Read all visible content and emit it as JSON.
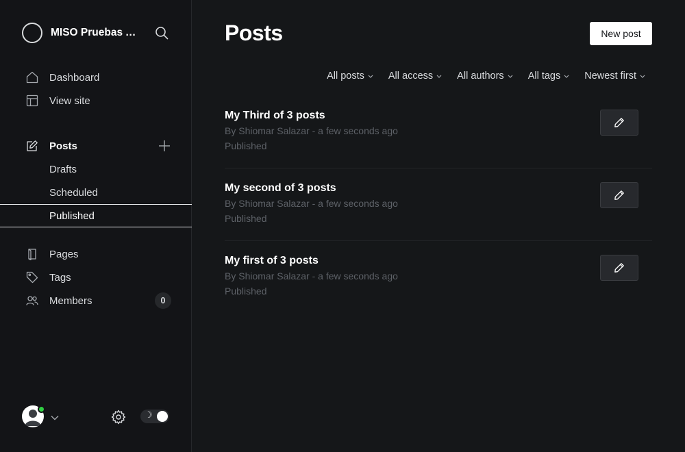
{
  "site": {
    "title": "MISO Pruebas Automatizadas"
  },
  "nav": {
    "dashboard": "Dashboard",
    "view_site": "View site",
    "posts": "Posts",
    "drafts": "Drafts",
    "scheduled": "Scheduled",
    "published": "Published",
    "pages": "Pages",
    "tags": "Tags",
    "members": "Members",
    "members_count": "0"
  },
  "main": {
    "title": "Posts",
    "new_post_label": "New post",
    "filters": [
      "All posts",
      "All access",
      "All authors",
      "All tags",
      "Newest first"
    ],
    "posts": [
      {
        "title": "My Third of 3 posts",
        "meta": "By Shiomar Salazar - a few seconds ago",
        "status": "Published"
      },
      {
        "title": "My second of 3 posts",
        "meta": "By Shiomar Salazar - a few seconds ago",
        "status": "Published"
      },
      {
        "title": "My first of 3 posts",
        "meta": "By Shiomar Salazar - a few seconds ago",
        "status": "Published"
      }
    ]
  },
  "colors": {
    "background": "#151719",
    "sidebar": "#131417",
    "online": "#30cf43",
    "muted": "#5d6167"
  },
  "icons": [
    "search-icon",
    "home-icon",
    "layout-icon",
    "edit-icon",
    "plus-icon",
    "page-icon",
    "tag-icon",
    "members-icon",
    "gear-icon",
    "moon-icon",
    "pencil-icon",
    "chevron-down-icon"
  ]
}
